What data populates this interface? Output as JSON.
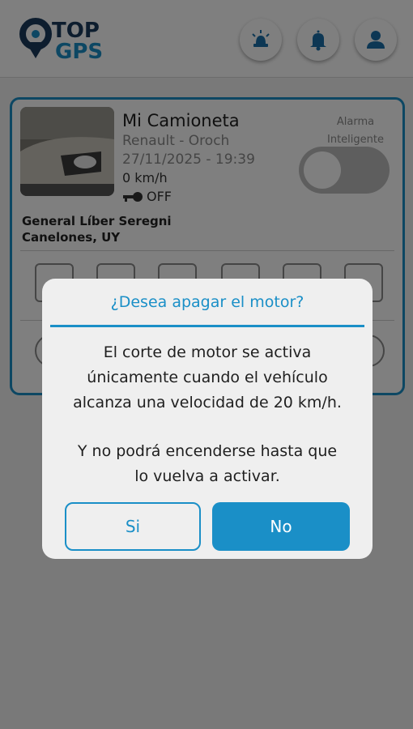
{
  "header": {
    "logo_line1": "TOP",
    "logo_line2": "GPS",
    "buttons": [
      "siren-icon",
      "bell-icon",
      "user-icon"
    ]
  },
  "vehicle": {
    "name": "Mi Camioneta",
    "model": "Renault - Oroch",
    "datetime": "27/11/2025 - 19:39",
    "speed": "0 km/h",
    "ignition": "OFF",
    "smart_alarm_label_1": "Alarma",
    "smart_alarm_label_2": "Inteligente",
    "smart_alarm_on": false,
    "address_line1": "General Líber Seregni",
    "address_line2": "Canelones,  UY"
  },
  "dialog": {
    "title": "¿Desea apagar el motor?",
    "message_line1": "El corte de motor se activa",
    "message_line2": "únicamente cuando el vehículo",
    "message_line3": "alcanza una velocidad de 20 km/h.",
    "message2_line1": "Y no podrá encenderse hasta que",
    "message2_line2": "lo vuelva a activar.",
    "yes_label": "Si",
    "no_label": "No"
  },
  "colors": {
    "accent": "#1a8fc7",
    "logo_dark": "#1b3a5c"
  }
}
